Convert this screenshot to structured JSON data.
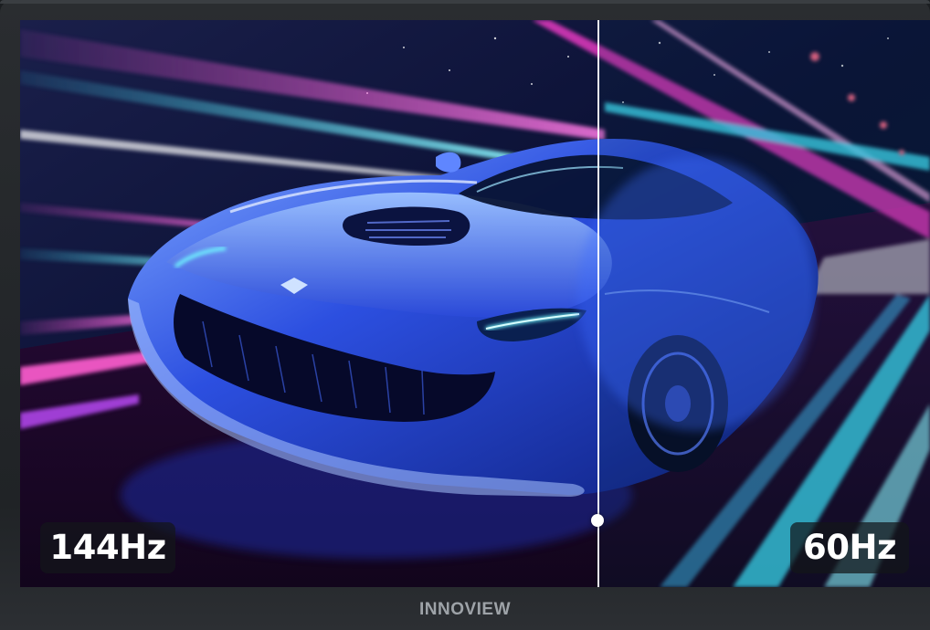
{
  "comparison": {
    "left_label": "144Hz",
    "right_label": "60Hz"
  },
  "monitor": {
    "brand": "INNOVIEW"
  },
  "colors": {
    "neon_pink": "#ff4fd8",
    "neon_cyan": "#3fe8ff",
    "car_blue": "#2f5cff",
    "bezel": "#25282b"
  }
}
